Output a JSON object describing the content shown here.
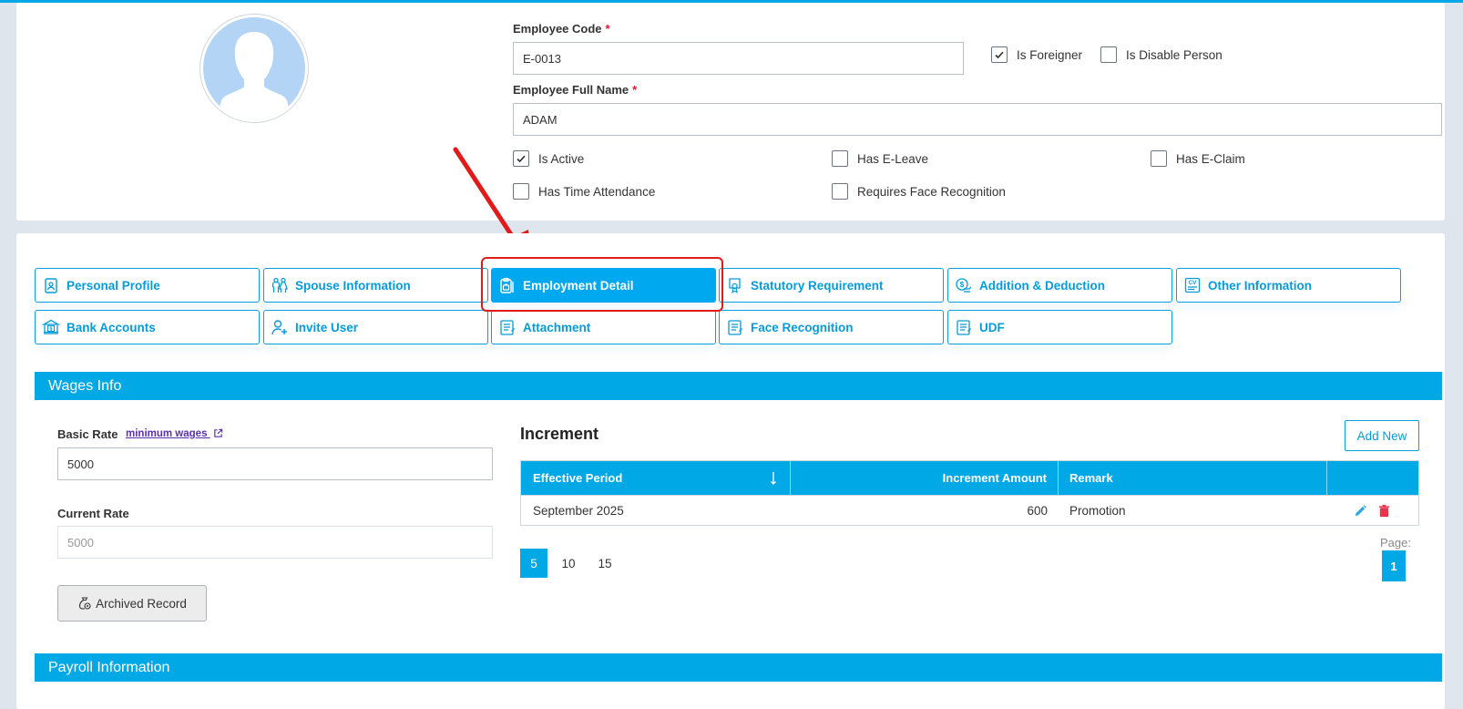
{
  "employee": {
    "code_label": "Employee Code",
    "code_value": "E-0013",
    "fullname_label": "Employee Full Name",
    "fullname_value": "ADAM",
    "required_mark": "*"
  },
  "flags": {
    "is_foreigner": {
      "label": "Is Foreigner",
      "checked": true
    },
    "is_disable_person": {
      "label": "Is Disable Person",
      "checked": false
    },
    "is_active": {
      "label": "Is Active",
      "checked": true
    },
    "has_eleave": {
      "label": "Has E-Leave",
      "checked": false
    },
    "has_eclaim": {
      "label": "Has E-Claim",
      "checked": false
    },
    "has_time_attendance": {
      "label": "Has Time Attendance",
      "checked": false
    },
    "requires_face_recognition": {
      "label": "Requires Face Recognition",
      "checked": false
    }
  },
  "tabs": [
    {
      "label": "Personal Profile",
      "icon": "id-badge-icon",
      "active": false
    },
    {
      "label": "Spouse Information",
      "icon": "couple-icon",
      "active": false
    },
    {
      "label": "Employment Detail",
      "icon": "briefcase-clipboard-icon",
      "active": true
    },
    {
      "label": "Statutory Requirement",
      "icon": "certificate-icon",
      "active": false
    },
    {
      "label": "Addition & Deduction",
      "icon": "money-icon",
      "active": false
    },
    {
      "label": "Other Information",
      "icon": "cv-icon",
      "active": false
    },
    {
      "label": "Bank Accounts",
      "icon": "bank-icon",
      "active": false
    },
    {
      "label": "Invite User",
      "icon": "add-user-icon",
      "active": false
    },
    {
      "label": "Attachment",
      "icon": "document-icon",
      "active": false
    },
    {
      "label": "Face Recognition",
      "icon": "document-edit-icon",
      "active": false
    },
    {
      "label": "UDF",
      "icon": "document-list-icon",
      "active": false
    }
  ],
  "wages": {
    "section_title": "Wages Info",
    "basic_rate_label": "Basic Rate",
    "minimum_wages_link": "minimum wages",
    "basic_rate_value": "5000",
    "current_rate_label": "Current Rate",
    "current_rate_value": "5000",
    "archived_button": "Archived Record"
  },
  "increment": {
    "title": "Increment",
    "add_button": "Add New",
    "columns": [
      "Effective Period",
      "Increment Amount",
      "Remark",
      ""
    ],
    "rows": [
      {
        "period": "September 2025",
        "amount": "600",
        "remark": "Promotion"
      }
    ],
    "page_sizes": [
      "5",
      "10",
      "15"
    ],
    "page_size_selected": "5",
    "page_label": "Page:",
    "current_page": "1"
  },
  "payroll": {
    "section_title": "Payroll Information"
  },
  "colors": {
    "accent": "#00a8e6",
    "highlight": "#e11a1a",
    "delete": "#e8344e"
  }
}
